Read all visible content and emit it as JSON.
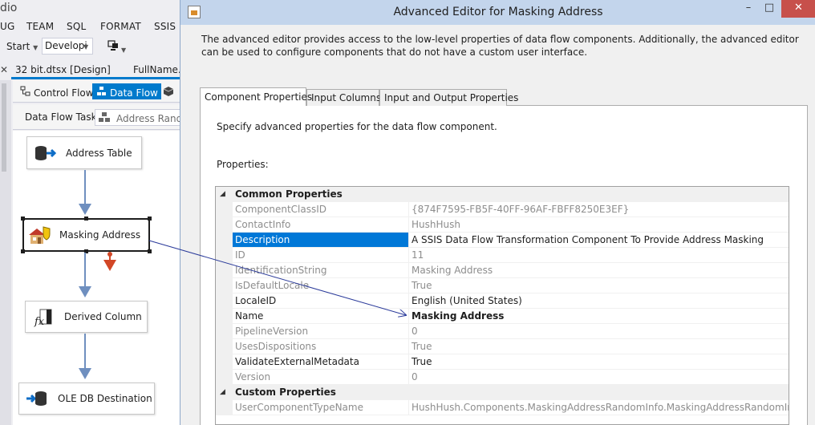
{
  "vs": {
    "title_fragment": "dio",
    "menu": [
      "UG",
      "TEAM",
      "SQL",
      "FORMAT",
      "SSIS"
    ],
    "toolbar": {
      "start_label": "Start",
      "config_value": "Developi"
    },
    "doc_tabs": [
      "32 bit.dtsx [Design]",
      "FullName.c"
    ],
    "designer_tabs": {
      "control_flow": "Control Flow",
      "data_flow": "Data Flow"
    },
    "task": {
      "label": "Data Flow Task:",
      "value": "Address Randon"
    },
    "nodes": {
      "address_table": "Address Table",
      "masking_address": "Masking Address",
      "derived_column": "Derived Column",
      "oledb_destination": "OLE DB Destination"
    },
    "colors": {
      "accent": "#007acc",
      "error_arrow": "#d24726",
      "path": "#6f8fbf"
    }
  },
  "dialog": {
    "title": "Advanced Editor for Masking Address",
    "description": "The advanced editor provides access to the low-level properties of data flow components. Additionally, the advanced editor can be used to configure components that do not have a custom user interface.",
    "tabs": [
      "Component Properties",
      "Input Columns",
      "Input and Output Properties"
    ],
    "active_tab": "Component Properties",
    "specify_text": "Specify advanced properties for the data flow component.",
    "properties_label": "Properties:",
    "categories": {
      "common": "Common Properties",
      "custom": "Custom Properties"
    },
    "common_rows": [
      {
        "name": "ComponentClassID",
        "value": "{874F7595-FB5F-40FF-96AF-FBFF8250E3EF}"
      },
      {
        "name": "ContactInfo",
        "value": "HushHush"
      },
      {
        "name": "Description",
        "value": "A SSIS Data Flow Transformation Component To Provide Address Masking"
      },
      {
        "name": "ID",
        "value": "11"
      },
      {
        "name": "IdentificationString",
        "value": "Masking Address"
      },
      {
        "name": "IsDefaultLocale",
        "value": "True"
      },
      {
        "name": "LocaleID",
        "value": "English (United States)"
      },
      {
        "name": "Name",
        "value": "Masking Address"
      },
      {
        "name": "PipelineVersion",
        "value": "0"
      },
      {
        "name": "UsesDispositions",
        "value": "True"
      },
      {
        "name": "ValidateExternalMetadata",
        "value": "True"
      },
      {
        "name": "Version",
        "value": "0"
      }
    ],
    "custom_rows": [
      {
        "name": "UserComponentTypeName",
        "value": "HushHush.Components.MaskingAddressRandomInfo.MaskingAddressRandomInfoComp"
      }
    ]
  }
}
